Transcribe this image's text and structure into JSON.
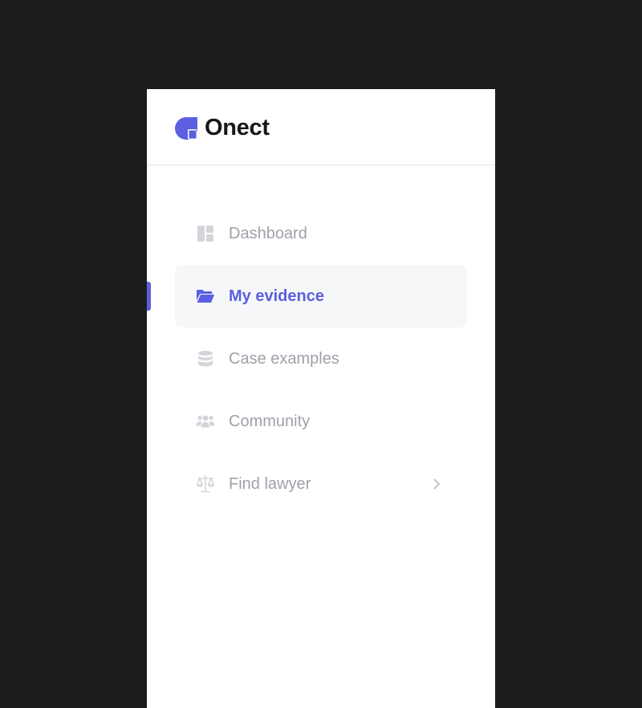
{
  "brand": {
    "name": "Onect",
    "logo_icon": "onect-logo-icon"
  },
  "colors": {
    "accent": "#5b5fe0",
    "muted_text": "#9ea1a9",
    "muted_icon": "#d3d5da",
    "active_bg": "#f6f7f9",
    "outer_bg": "#1c1c1e"
  },
  "nav": {
    "items": [
      {
        "label": "Dashboard",
        "icon": "dashboard-icon",
        "active": false
      },
      {
        "label": "My evidence",
        "icon": "folder-open-icon",
        "active": true
      },
      {
        "label": "Case examples",
        "icon": "database-icon",
        "active": false
      },
      {
        "label": "Community",
        "icon": "users-icon",
        "active": false
      },
      {
        "label": "Find lawyer",
        "icon": "scale-icon",
        "active": false,
        "trailing_icon": "chevron-right-icon"
      }
    ]
  }
}
